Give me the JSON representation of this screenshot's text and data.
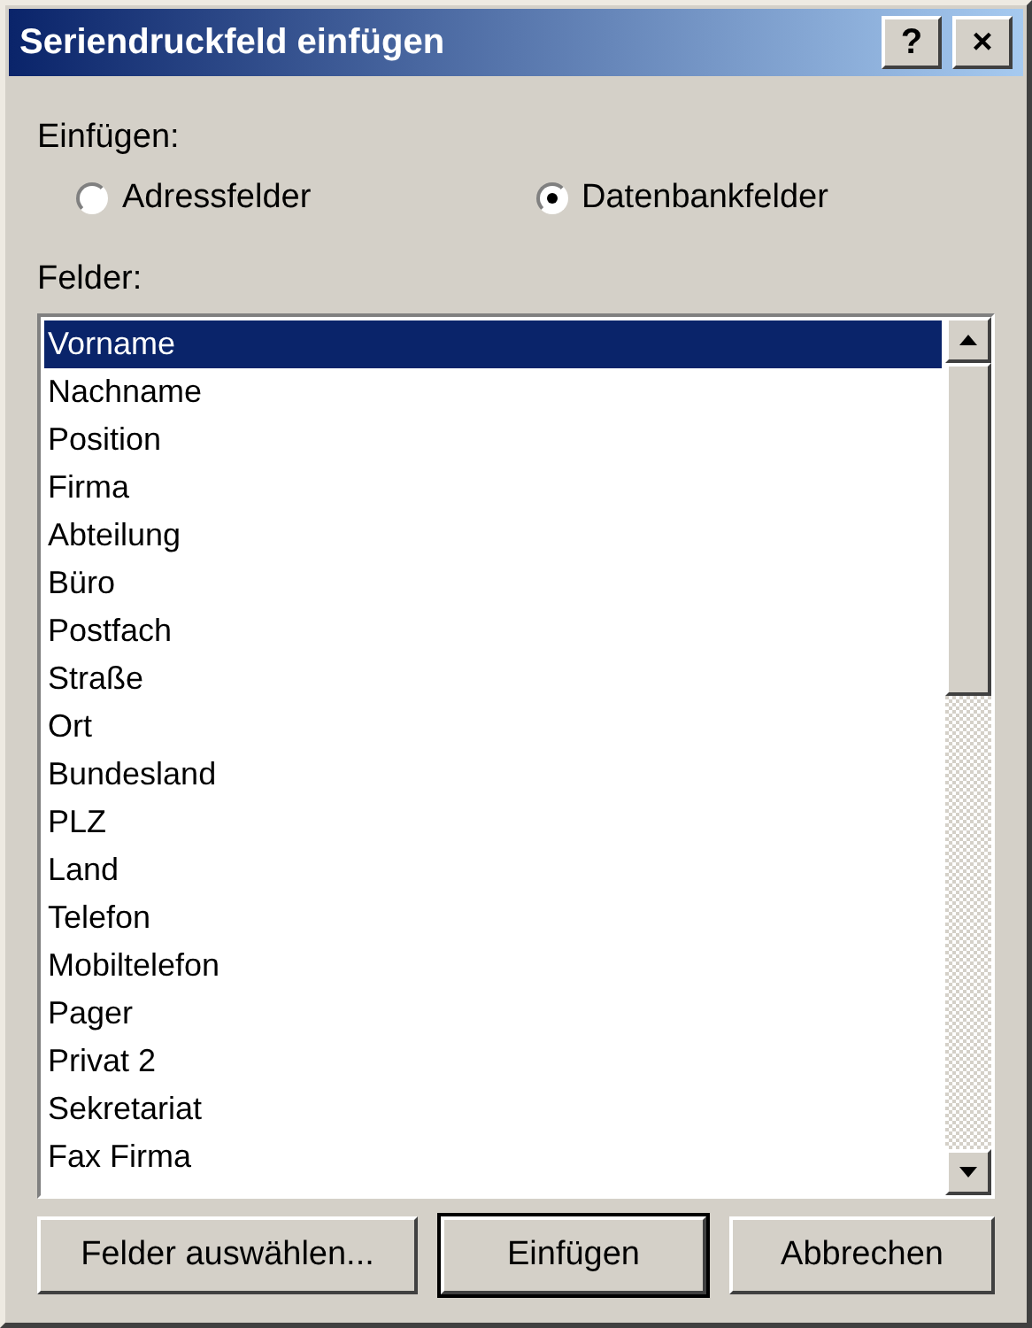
{
  "window": {
    "title": "Seriendruckfeld einfügen",
    "help": "?",
    "close": "×"
  },
  "insert": {
    "label": "Einfügen:",
    "options": [
      {
        "label": "Adressfelder",
        "selected": false
      },
      {
        "label": "Datenbankfelder",
        "selected": true
      }
    ]
  },
  "fields": {
    "label": "Felder:",
    "items": [
      {
        "label": "Vorname",
        "selected": true
      },
      {
        "label": "Nachname",
        "selected": false
      },
      {
        "label": "Position",
        "selected": false
      },
      {
        "label": "Firma",
        "selected": false
      },
      {
        "label": "Abteilung",
        "selected": false
      },
      {
        "label": "Büro",
        "selected": false
      },
      {
        "label": "Postfach",
        "selected": false
      },
      {
        "label": "Straße",
        "selected": false
      },
      {
        "label": "Ort",
        "selected": false
      },
      {
        "label": "Bundesland",
        "selected": false
      },
      {
        "label": "PLZ",
        "selected": false
      },
      {
        "label": "Land",
        "selected": false
      },
      {
        "label": "Telefon",
        "selected": false
      },
      {
        "label": "Mobiltelefon",
        "selected": false
      },
      {
        "label": "Pager",
        "selected": false
      },
      {
        "label": "Privat 2",
        "selected": false
      },
      {
        "label": "Sekretariat",
        "selected": false
      },
      {
        "label": "Fax Firma",
        "selected": false
      }
    ]
  },
  "buttons": [
    {
      "label": "Felder auswählen...",
      "default": false
    },
    {
      "label": "Einfügen",
      "default": true
    },
    {
      "label": "Abbrechen",
      "default": false
    }
  ]
}
